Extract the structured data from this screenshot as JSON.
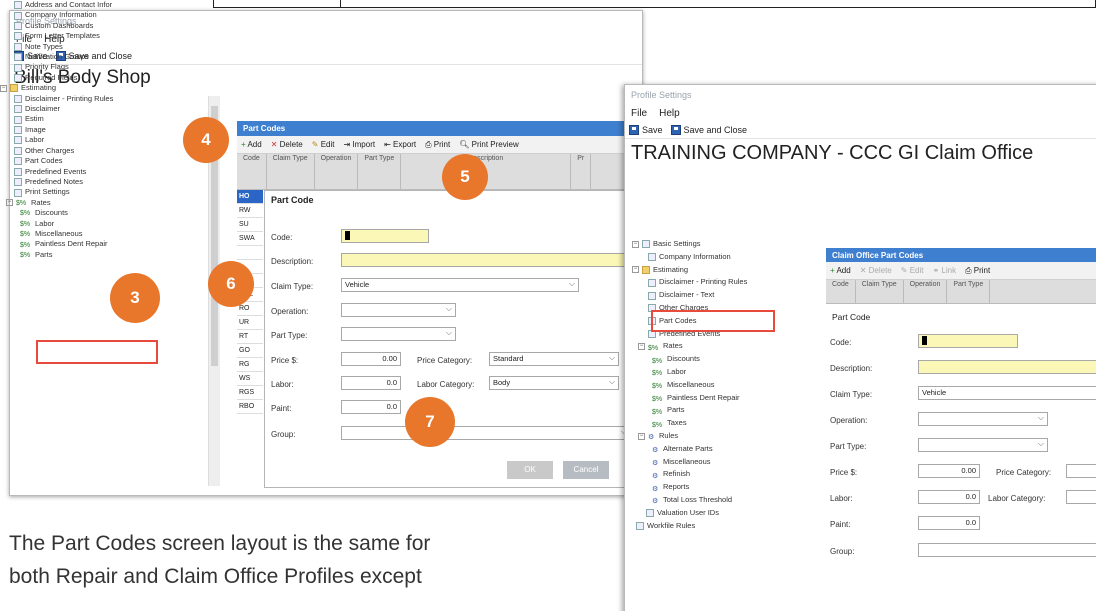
{
  "window1": {
    "title": "Profile Settings",
    "menu": [
      "File",
      "Help"
    ],
    "toolbar": {
      "save": "Save",
      "save_close": "Save and Close"
    },
    "company": "Bill's Body Shop",
    "tree": [
      "Address and Contact Infor",
      "Company Information",
      "Custom Dashboards",
      "Form Letter Templates",
      "Note Types",
      "Notification Groups",
      "Priority Flags",
      "Required Fields",
      "Estimating",
      "Disclaimer - Printing Rules",
      "Disclaimer",
      "Estim",
      "Image",
      "Labor",
      "Other Charges",
      "Part Codes",
      "Predefined Events",
      "Predefined Notes",
      "Print Settings",
      "Rates",
      "Discounts",
      "Labor",
      "Miscellaneous",
      "Paintless Dent Repair",
      "Parts"
    ],
    "panel_title": "Part Codes",
    "grid_toolbar": [
      "Add",
      "Delete",
      "Edit",
      "Import",
      "Export",
      "Print",
      "Print Preview"
    ],
    "grid_headers": [
      "Code",
      "Claim Type",
      "Operation",
      "Part Type",
      "Description",
      "Pr"
    ],
    "codes": [
      "HO",
      "RW",
      "SU",
      "SWA",
      "",
      "",
      "",
      "RCL",
      "RO",
      "UR",
      "RT",
      "GO",
      "RG",
      "WS",
      "RGS",
      "RBO"
    ],
    "dialog": {
      "title": "Part Code",
      "code_label": "Code:",
      "description_label": "Description:",
      "claim_type_label": "Claim Type:",
      "claim_type_value": "Vehicle",
      "operation_label": "Operation:",
      "part_type_label": "Part Type:",
      "price_label": "Price $:",
      "price_value": "0.00",
      "price_category_label": "Price Category:",
      "price_category_value": "Standard",
      "labor_label": "Labor:",
      "labor_value": "0.0",
      "labor_category_label": "Labor Category:",
      "labor_category_value": "Body",
      "paint_label": "Paint:",
      "paint_value": "0.0",
      "group_label": "Group:",
      "ok": "OK",
      "cancel": "Cancel"
    }
  },
  "window2": {
    "title": "Profile Settings",
    "menu": [
      "File",
      "Help"
    ],
    "toolbar": {
      "save": "Save",
      "save_close": "Save and Close"
    },
    "company": "TRAINING COMPANY - CCC GI Claim Office",
    "tree": [
      "Basic Settings",
      "Company Information",
      "Estimating",
      "Disclaimer - Printing Rules",
      "Disclaimer - Text",
      "Other Charges",
      "Part Codes",
      "Predefined Events",
      "Rates",
      "Discounts",
      "Labor",
      "Miscellaneous",
      "Paintless Dent Repair",
      "Parts",
      "Taxes",
      "Rules",
      "Alternate Parts",
      "Miscellaneous",
      "Refinish",
      "Reports",
      "Total Loss Threshold",
      "Valuation User IDs",
      "Workfile Rules"
    ],
    "panel_title": "Claim Office Part Codes",
    "grid_toolbar": [
      "Add",
      "Delete",
      "Edit",
      "Link",
      "Print"
    ],
    "grid_headers": [
      "Code",
      "Claim Type",
      "Operation",
      "Part Type"
    ],
    "dialog": {
      "title": "Part Code",
      "code_label": "Code:",
      "description_label": "Description:",
      "claim_type_label": "Claim Type:",
      "claim_type_value": "Vehicle",
      "operation_label": "Operation:",
      "part_type_label": "Part Type:",
      "price_label": "Price $:",
      "price_value": "0.00",
      "price_category_label": "Price Category:",
      "labor_label": "Labor:",
      "labor_value": "0.0",
      "labor_category_label": "Labor Category:",
      "paint_label": "Paint:",
      "paint_value": "0.0",
      "group_label": "Group:"
    }
  },
  "badges": [
    "4",
    "5",
    "6",
    "3",
    "7"
  ],
  "caption": {
    "line1": "The Part Codes screen layout is the same for",
    "line2": "both Repair and Claim Office Profiles except"
  },
  "colors": {
    "badge": "#e8762b",
    "highlight": "#e84b3c",
    "header_blue": "#3f7fcf",
    "yellow_field": "#fbf7b6"
  }
}
